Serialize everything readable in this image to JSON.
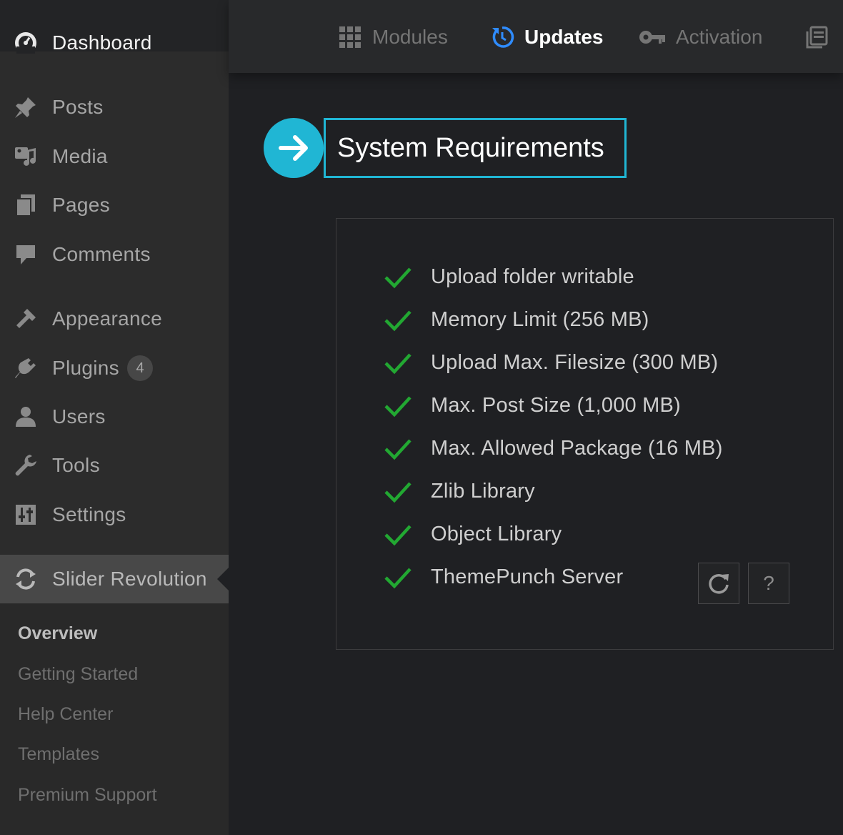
{
  "sidebar": {
    "dashboard": "Dashboard",
    "items": [
      {
        "label": "Posts",
        "icon": "pin-icon"
      },
      {
        "label": "Media",
        "icon": "media-icon"
      },
      {
        "label": "Pages",
        "icon": "pages-icon"
      },
      {
        "label": "Comments",
        "icon": "comment-icon"
      },
      {
        "label": "Appearance",
        "icon": "brush-icon"
      },
      {
        "label": "Plugins",
        "icon": "plugin-icon",
        "badge": "4"
      },
      {
        "label": "Users",
        "icon": "user-icon"
      },
      {
        "label": "Tools",
        "icon": "wrench-icon"
      },
      {
        "label": "Settings",
        "icon": "sliders-icon"
      }
    ],
    "active_plugin": "Slider Revolution",
    "submenu": [
      "Overview",
      "Getting Started",
      "Help Center",
      "Templates",
      "Premium Support"
    ]
  },
  "topbar": {
    "tabs": [
      {
        "label": "Modules",
        "icon": "grid-icon"
      },
      {
        "label": "Updates",
        "icon": "update-icon",
        "active": true
      },
      {
        "label": "Activation",
        "icon": "key-icon"
      },
      {
        "label": "",
        "icon": "docs-icon"
      }
    ]
  },
  "heading": {
    "title": "System Requirements"
  },
  "requirements": [
    "Upload folder writable",
    "Memory Limit (256 MB)",
    "Upload Max. Filesize (300 MB)",
    "Max. Post Size (1,000 MB)",
    "Max. Allowed Package (16 MB)",
    "Zlib Library",
    "Object Library",
    "ThemePunch Server"
  ],
  "buttons": {
    "help": "?"
  },
  "colors": {
    "accent": "#20b6d4",
    "check": "#22a832",
    "active_tab_icon": "#2f8cff"
  }
}
